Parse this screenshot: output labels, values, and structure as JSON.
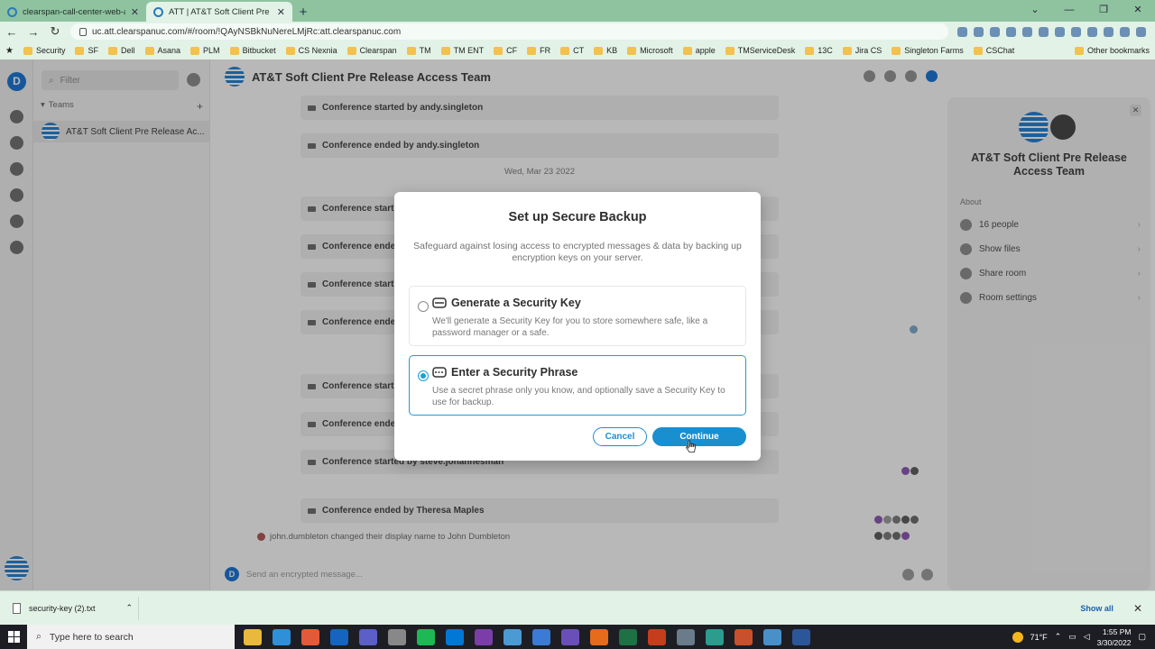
{
  "browser": {
    "tabs": [
      {
        "title": "clearspan-call-center-web-app",
        "active": false
      },
      {
        "title": "ATT | AT&T Soft Client Pre Release",
        "active": true
      }
    ],
    "url": "uc.att.clearspanuc.com/#/room/!QAyNSBkNuNereLMjRc:att.clearspanuc.com",
    "bookmarks": [
      "Security",
      "SF",
      "Dell",
      "Asana",
      "PLM",
      "Bitbucket",
      "CS Nexnia",
      "Clearspan",
      "TM",
      "TM ENT",
      "CF",
      "FR",
      "CT",
      "KB",
      "Microsoft",
      "apple",
      "TMServiceDesk",
      "13C",
      "Jira CS",
      "Singleton Farms",
      "CSChat"
    ],
    "other_bookmarks": "Other bookmarks"
  },
  "sidebar": {
    "user_initial": "D",
    "filter_placeholder": "Filter",
    "teams_label": "Teams",
    "room_name": "AT&T Soft Client Pre Release Ac..."
  },
  "room": {
    "title": "AT&T Soft Client Pre Release Access Team",
    "events_top": [
      "Conference started by andy.singleton",
      "Conference ended by andy.singleton"
    ],
    "date_separator": "Wed, Mar 23 2022",
    "events_partial": [
      "Conference start",
      "Conference ende",
      "Conference start",
      "Conference ende",
      "Conference start",
      "Conference ende"
    ],
    "event_steve": "Conference started by steve.johannesman",
    "event_theresa": "Conference ended by Theresa Maples",
    "notice": "john.dumbleton changed their display name to John Dumbleton",
    "composer_initial": "D",
    "composer_placeholder": "Send an encrypted message..."
  },
  "right_panel": {
    "name": "AT&T Soft Client Pre Release Access Team",
    "about_label": "About",
    "items": [
      "16 people",
      "Show files",
      "Share room",
      "Room settings"
    ]
  },
  "modal": {
    "title": "Set up Secure Backup",
    "description": "Safeguard against losing access to encrypted messages & data by backing up encryption keys on your server.",
    "options": [
      {
        "title": "Generate a Security Key",
        "description": "We'll generate a Security Key for you to store somewhere safe, like a password manager or a safe.",
        "selected": false
      },
      {
        "title": "Enter a Security Phrase",
        "description": "Use a secret phrase only you know, and optionally save a Security Key to use for backup.",
        "selected": true
      }
    ],
    "cancel_label": "Cancel",
    "continue_label": "Continue",
    "accent_color": "#1a8fd0"
  },
  "downloads": {
    "file": "security-key (2).txt",
    "show_all": "Show all"
  },
  "taskbar": {
    "search_placeholder": "Type here to search",
    "temperature": "71°F",
    "time": "1:55 PM",
    "date": "3/30/2022"
  }
}
